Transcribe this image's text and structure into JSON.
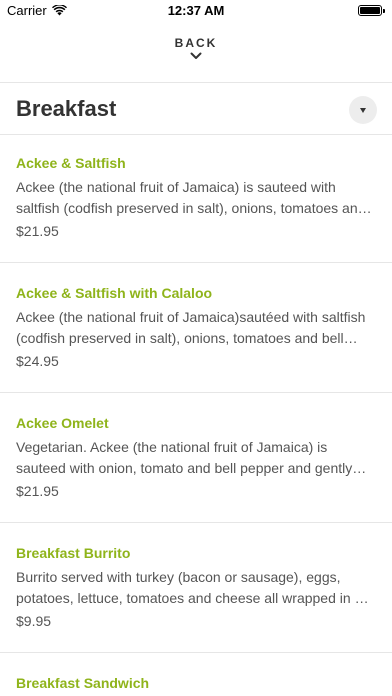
{
  "status_bar": {
    "carrier": "Carrier",
    "time": "12:37 AM"
  },
  "nav": {
    "back_label": "BACK"
  },
  "category": {
    "title": "Breakfast"
  },
  "items": [
    {
      "name": "Ackee & Saltfish",
      "description": "Ackee (the national fruit of Jamaica) is sauteed with saltfish (codfish preserved in salt), onions, tomatoes and bell peppers.",
      "price": "$21.95"
    },
    {
      "name": "Ackee & Saltfish with Calaloo",
      "description": "Ackee (the national fruit of Jamaica)sautéed with saltfish (codfish preserved in salt), onions, tomatoes and bell peppers.",
      "price": "$24.95"
    },
    {
      "name": "Ackee Omelet",
      "description": "Vegetarian. Ackee (the national fruit of Jamaica) is sauteed with onion, tomato and bell pepper and gently folded into an omelet.",
      "price": "$21.95"
    },
    {
      "name": "Breakfast Burrito",
      "description": "Burrito served with turkey (bacon or sausage), eggs, potatoes, lettuce, tomatoes and cheese all wrapped in a tortilla.",
      "price": "$9.95"
    },
    {
      "name": "Breakfast Sandwich",
      "description": "",
      "price": ""
    }
  ],
  "colors": {
    "accent": "#8fb41b",
    "text": "#333333",
    "muted": "#555555",
    "divider": "#e6e6e6"
  }
}
